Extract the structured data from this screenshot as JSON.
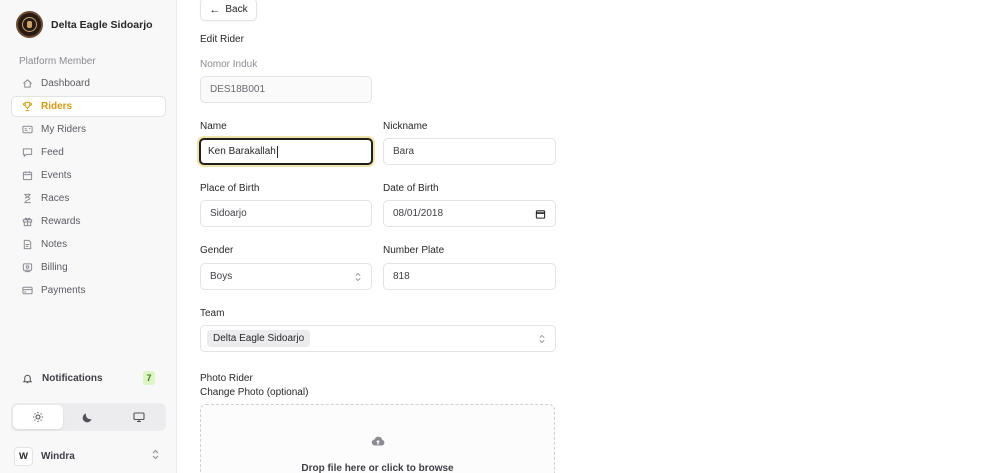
{
  "brand": {
    "name": "Delta Eagle Sidoarjo"
  },
  "sidebar": {
    "section_label": "Platform Member",
    "items": [
      {
        "label": "Dashboard",
        "icon": "home-icon"
      },
      {
        "label": "Riders",
        "icon": "trophy-icon",
        "active": true
      },
      {
        "label": "My Riders",
        "icon": "id-card-icon"
      },
      {
        "label": "Feed",
        "icon": "chat-icon"
      },
      {
        "label": "Events",
        "icon": "calendar-icon"
      },
      {
        "label": "Races",
        "icon": "hourglass-icon"
      },
      {
        "label": "Rewards",
        "icon": "gift-icon"
      },
      {
        "label": "Notes",
        "icon": "document-icon"
      },
      {
        "label": "Billing",
        "icon": "receipt-icon"
      },
      {
        "label": "Payments",
        "icon": "credit-card-icon"
      }
    ],
    "notifications": {
      "label": "Notifications",
      "count": "7"
    },
    "user": {
      "initial": "W",
      "name": "Windra"
    }
  },
  "colors": {
    "accent": "#d39a12",
    "badge_bg": "#dcf7c5",
    "focus_ring": "#f0e3a6"
  },
  "main": {
    "back_label": "Back",
    "title": "Edit Rider",
    "fields": {
      "nomor_induk": {
        "label": "Nomor Induk",
        "value": "DES18B001"
      },
      "name": {
        "label": "Name",
        "value": "Ken Barakallah"
      },
      "nickname": {
        "label": "Nickname",
        "value": "Bara"
      },
      "place_of_birth": {
        "label": "Place of Birth",
        "value": "Sidoarjo"
      },
      "date_of_birth": {
        "label": "Date of Birth",
        "value": "08/01/2018"
      },
      "gender": {
        "label": "Gender",
        "value": "Boys"
      },
      "number_plate": {
        "label": "Number Plate",
        "value": "818"
      },
      "team": {
        "label": "Team",
        "value": "Delta Eagle Sidoarjo"
      }
    },
    "photo": {
      "label": "Photo Rider",
      "sublabel": "Change Photo (optional)",
      "dropzone_text": "Drop file here or click to browse"
    }
  }
}
